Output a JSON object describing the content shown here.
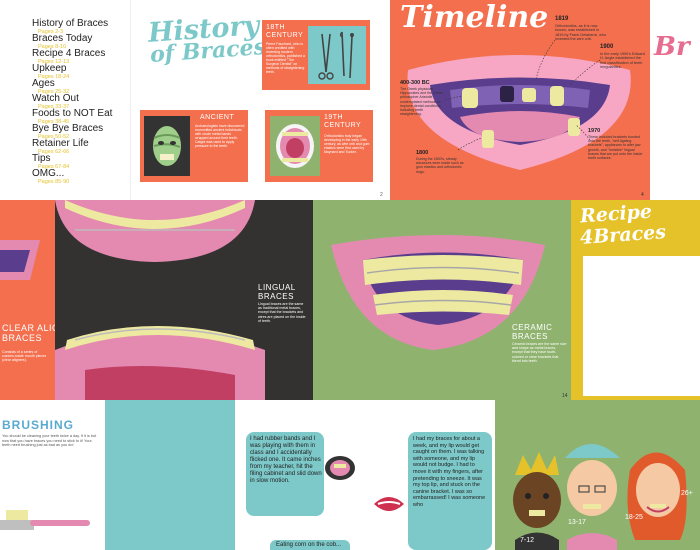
{
  "toc": [
    {
      "title": "History of Braces",
      "pages": "Pages 2-3"
    },
    {
      "title": "Braces Today",
      "pages": "Pages 8-10"
    },
    {
      "title": "Recipe 4 Braces",
      "pages": "Pages 12-13"
    },
    {
      "title": "Upkeep",
      "pages": "Pages 18-24"
    },
    {
      "title": "Ages",
      "pages": "Pages 25-32"
    },
    {
      "title": "Watch Out",
      "pages": "Pages 33-37"
    },
    {
      "title": "Foods to NOT Eat",
      "pages": "Pages 38-45"
    },
    {
      "title": "Bye Bye Braces",
      "pages": "Pages 50-52"
    },
    {
      "title": "Retainer Life",
      "pages": "Pages 62-66"
    },
    {
      "title": "Tips",
      "pages": "Pages 67-84"
    },
    {
      "title": "OMG...",
      "pages": "Pages 85-90"
    }
  ],
  "history": {
    "title_line1": "History",
    "title_line2": "of Braces",
    "box_18th_label": "18TH CENTURY",
    "box_18th_text": "Pierre Fauchard, who is often credited with inventing modern orthodontics, published a book entitled \"The Surgeon Dentist\" on methods of straightening teeth.",
    "box_ancient_label": "ANCIENT",
    "box_ancient_text": "Archaeologists have discovered mummified ancient individuals with crude metal bands wrapped around their teeth. Catgut was used to apply pressure to the teeth.",
    "box_19th_label": "19TH CENTURY",
    "box_19th_text": "Orthodontics truly began developing in the early 19th century, as wire crib and gum elastics were first used by Maynard and Tucker.",
    "page_num": "2"
  },
  "timeline": {
    "title": "Timeline",
    "e1819_year": "1819",
    "e1819_text": "Orthodontics, as it is now known, was established in 1819 by Frank Delabarre, who invented the wire crib.",
    "e1900_year": "1900",
    "e1900_text": "In the early 1900's Edward H. Angle established the first classification of teeth irregularities.",
    "e400_year": "400-300 BC",
    "e400_text": "The Greek physician Hippocrates and the Greek philosopher Aristotle contemplated methods to improve dental conditions, including teeth straightening.",
    "e1800_year": "1800",
    "e1800_text": "During the 1800's, steady advances were made such as gum elastics and orthodontic rings.",
    "e1970_year": "1970",
    "e1970_text": "These included brackets bonded onto the teeth, \"self-ligating brackets\", appliances to alter jaw growth, and \"invisible\" lingual braces that are put onto the inside teeth surfaces.",
    "page_num": "4",
    "next_title_partial": "Br"
  },
  "row2": {
    "clear_align_label": "CLEAR ALIGN",
    "clear_align_label2": "BRACES",
    "clear_align_text": "Consists of a series of custom-made mouth pieces (clear aligners).",
    "lingual_label": "LINGUAL BRACES",
    "lingual_text": "Lingual braces are the same as traditional metal braces, except that the brackets and wires are placed on the inside of teeth.",
    "ceramic_label": "CERAMIC BRACES",
    "ceramic_text": "Ceramic braces are the same size and shape as metal braces, except that they have tooth-colored or clear brackets that blend into teeth.",
    "page_num": "14",
    "recipe_title1": "Recipe",
    "recipe_title2": "4Braces"
  },
  "row3": {
    "brushing_title": "BRUSHING",
    "brushing_text": "You should be cleaning your teeth twice a day. If it is but now that you have braces you need to stick to it! Your teeth need brushing just as bad as you do!",
    "story1": "I had rubber bands and I was playing with them in class and I accidentally flicked one. It came inches from my teacher, hit the filing cabinet and slid down in slow motion.",
    "story2": "I had my braces for about a week, and my lip would get caught on them. I was talking with someone, and my lip would not budge. I had to move it with my fingers, after pretending to sneeze. It was my top lip, and stuck on the canine bracket. I was so embarrassed! I was someone who",
    "story3": "Eating corn on the cob...",
    "age1": "7-12",
    "age2": "13-17",
    "age3": "18-25",
    "age4": "26+"
  },
  "colors": {
    "orange": "#f36f4e",
    "teal": "#7dc8c9",
    "yellow": "#e6c22a",
    "green": "#8fb36f",
    "dark": "#343131",
    "pink": "#e48ab0"
  }
}
